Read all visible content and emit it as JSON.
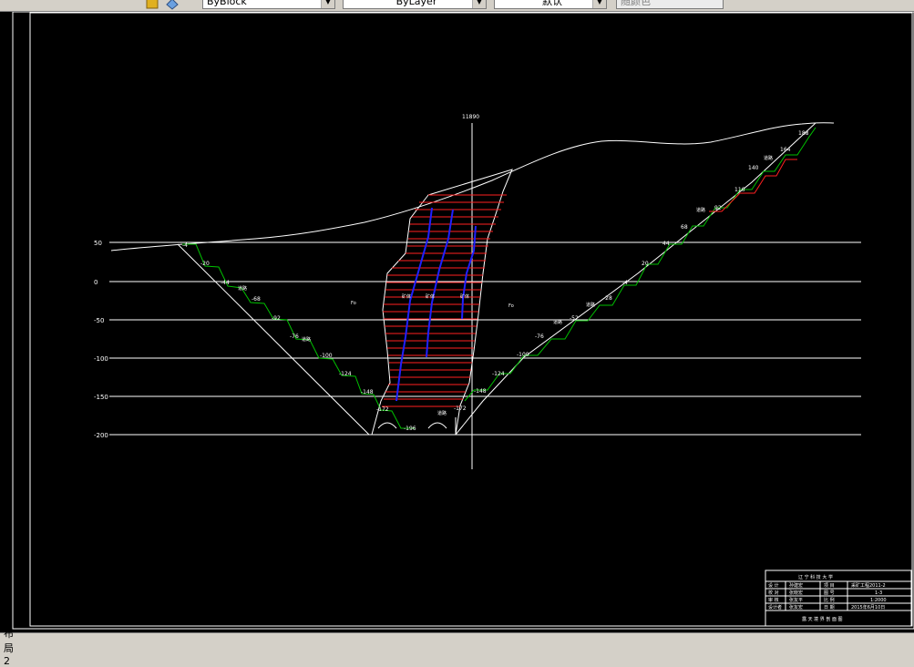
{
  "toolbar": {
    "linetype_value": "ByBlock",
    "layer_value": "ByLayer",
    "lineweight_value": "默认",
    "plotstyle_value": "随颜色"
  },
  "drawing": {
    "axis_label": "11890",
    "elevations": [
      "50",
      "0",
      "-50",
      "-100",
      "-150",
      "-200"
    ],
    "left_levels": [
      "-4",
      "-20",
      "-44",
      "-68",
      "-92",
      "-76",
      "-100",
      "-124",
      "-148",
      "-172"
    ],
    "right_levels": [
      "188",
      "164",
      "140",
      "116",
      "92",
      "68",
      "44",
      "20",
      "-4",
      "-28",
      "-52",
      "-76",
      "-100",
      "-124",
      "-148",
      "-172"
    ],
    "bottom_level": "-196",
    "ramp_label": "道路",
    "zone_label_left": "Fo",
    "zone_label_right": "Fo",
    "ore_labels": [
      "矿体",
      "矿体",
      "矿体"
    ]
  },
  "title_block": {
    "header": "辽 宁 科 技 大 学",
    "rows": [
      [
        "设  计",
        "孙建宏",
        "项  目",
        "采矿工程2011-2"
      ],
      [
        "校  对",
        "张晓宏",
        "图  号",
        "1-3"
      ],
      [
        "审  核",
        "张友平",
        "比  例",
        "1:2000"
      ],
      [
        "设计者",
        "张友宏",
        "日  期",
        "2015年6月10日"
      ]
    ],
    "footer": "露 天 境 界 剖 面 图"
  },
  "status": {
    "layout_tab": "布局2"
  },
  "colors": {
    "background": "#000000",
    "lines": "#ffffff",
    "slope_steps": "#00c000",
    "ore_hatch": "#ff2020",
    "drill_holes": "#0000ff"
  }
}
